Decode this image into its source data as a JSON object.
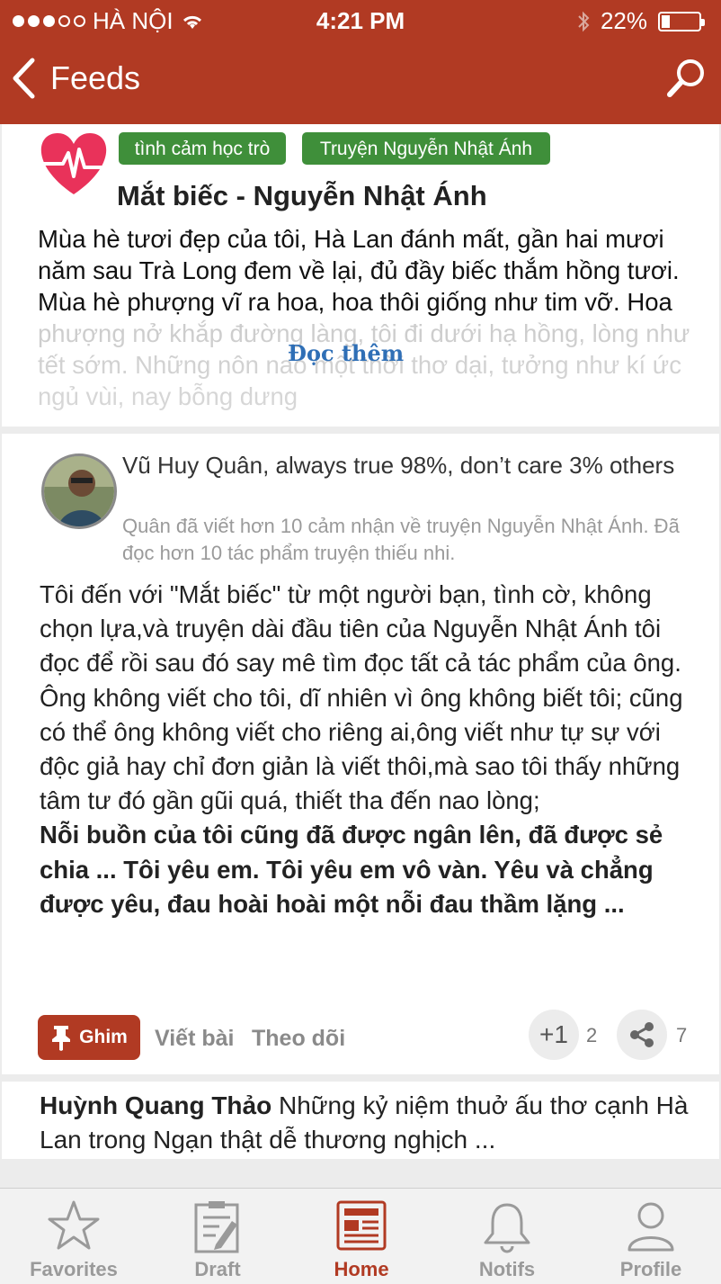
{
  "status_bar": {
    "carrier": "HÀ NỘI",
    "time": "4:21 PM",
    "battery": "22%",
    "battery_level": 0.22,
    "signal_dots": [
      true,
      true,
      true,
      false,
      false
    ]
  },
  "navbar": {
    "back_label": "Feeds",
    "search_icon": "search-icon"
  },
  "feature_card": {
    "icon": "heartbeat-icon",
    "tags": [
      "tình cảm học trò",
      "Truyện Nguyễn Nhật Ánh"
    ],
    "title": "Mắt biếc - Nguyễn Nhật Ánh",
    "excerpt": "Mùa hè tươi đẹp của tôi, Hà Lan đánh mất, gần hai mươi năm sau Trà Long đem về lại, đủ đầy biếc thắm hồng tươi. Mùa hè phượng vĩ ra hoa, hoa thôi giống như tim vỡ. Hoa phượng nở khắp đường làng, tôi đi dưới hạ hồng, lòng như tết sớm. Những nôn nao một thời thơ dại, tưởng như kí ức ngủ vùi, nay bỗng dưng",
    "read_more": "Đọc thêm"
  },
  "post_card": {
    "author_line": "Vũ Huy Quân,  always true 98%, don’t care 3% others",
    "author_bio": "Quân đã viết hơn 10 cảm nhận về truyện Nguyễn Nhật Ánh. Đã đọc hơn 10 tác phẩm truyện thiếu nhi.",
    "body": "Tôi đến với \"Mắt biếc\"  từ một người bạn, tình cờ, không chọn lựa,và truyện dài đầu tiên của Nguyễn Nhật Ánh tôi đọc để rồi sau đó say mê tìm đọc tất cả tác phẩm của ông. Ông không viết cho tôi, dĩ nhiên vì ông không biết tôi; cũng có thể ông không viết cho riêng ai,ông viết như tự sự với độc giả hay chỉ đơn giản là viết thôi,mà sao tôi thấy những tâm tư đó gần gũi quá, thiết tha đến nao lòng;",
    "body_bold": "Nỗi buồn của tôi cũng đã được ngân lên, đã được sẻ chia ... Tôi yêu em. Tôi yêu em vô vàn. Yêu và chẳng được yêu, đau hoài hoài một nỗi  đau thầm lặng ...",
    "actions": {
      "pin": "Ghim",
      "write": "Viết bài",
      "follow": "Theo dõi",
      "plus_label": "+1",
      "plus_count": "2",
      "share_count": "7"
    }
  },
  "preview_card": {
    "name": "Huỳnh Quang Thảo",
    "text": " Những kỷ niệm thuở ấu thơ cạnh Hà Lan trong Ngạn thật dễ thương nghịch ..."
  },
  "tabbar": {
    "tabs": [
      {
        "label": "Favorites",
        "icon": "star-icon"
      },
      {
        "label": "Draft",
        "icon": "draft-icon"
      },
      {
        "label": "Home",
        "icon": "newspaper-icon",
        "active": true
      },
      {
        "label": "Notifs",
        "icon": "bell-icon"
      },
      {
        "label": "Profile",
        "icon": "user-icon"
      }
    ]
  },
  "colors": {
    "brand_red": "#b13a23",
    "tag_green": "#3f8f3a",
    "link_blue": "#2f6fb6"
  }
}
